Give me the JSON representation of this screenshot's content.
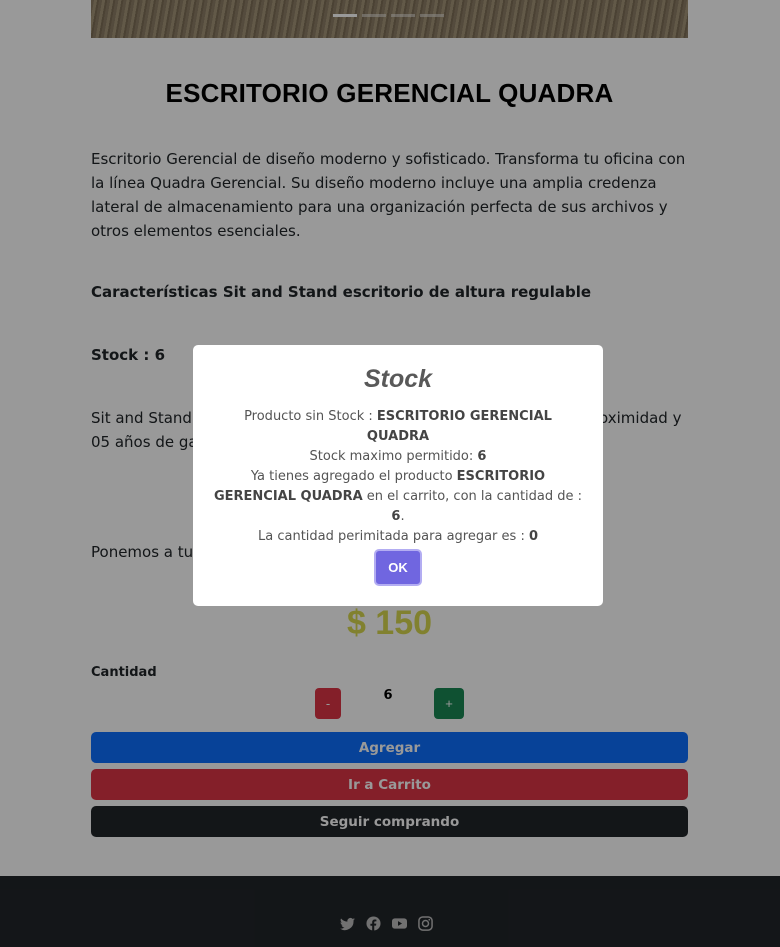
{
  "product": {
    "title": "ESCRITORIO GERENCIAL QUADRA",
    "description": "Escritorio Gerencial de diseño moderno y sofisticado. Transforma tu oficina con la línea Quadra Gerencial. Su diseño moderno incluye una amplia credenza lateral de almacenamiento para una organización perfecta de sus archivos y otros elementos esenciales.",
    "features_heading": "Características Sit and Stand escritorio de altura regulable",
    "stock_label": "Stock : 6",
    "paragraph1": "Sit and Stand – … rencia de otros modelos … uido (>50db) que s… oximidad y 05 años de gar…",
    "paragraph2": "Ponemos a tu … maños de tablero, 04 colo…",
    "price": "$ 150",
    "currency_color": "#d8d84f"
  },
  "quantity": {
    "label": "Cantidad",
    "minus": "-",
    "value": "6",
    "plus": "+"
  },
  "actions": {
    "add": "Agregar",
    "cart": "Ir a Carrito",
    "continue": "Seguir comprando"
  },
  "footer": {
    "social_icons": [
      "twitter-icon",
      "facebook-icon",
      "youtube-icon",
      "instagram-icon"
    ]
  },
  "modal": {
    "title": "Stock",
    "line1_prefix": "Producto sin Stock : ",
    "line1_product": "ESCRITORIO GERENCIAL QUADRA",
    "line2_prefix": "Stock maximo permitido: ",
    "line2_value": "6",
    "line3_prefix": "Ya tienes agregado el producto ",
    "line3_product": "ESCRITORIO GERENCIAL QUADRA",
    "line3_middle": " en el carrito, con la cantidad de : ",
    "line3_value": "6",
    "line3_suffix": ".",
    "line4_prefix": "La cantidad perimitada para agregar es : ",
    "line4_value": "0",
    "ok": "OK",
    "ok_color": "#7066e0"
  }
}
